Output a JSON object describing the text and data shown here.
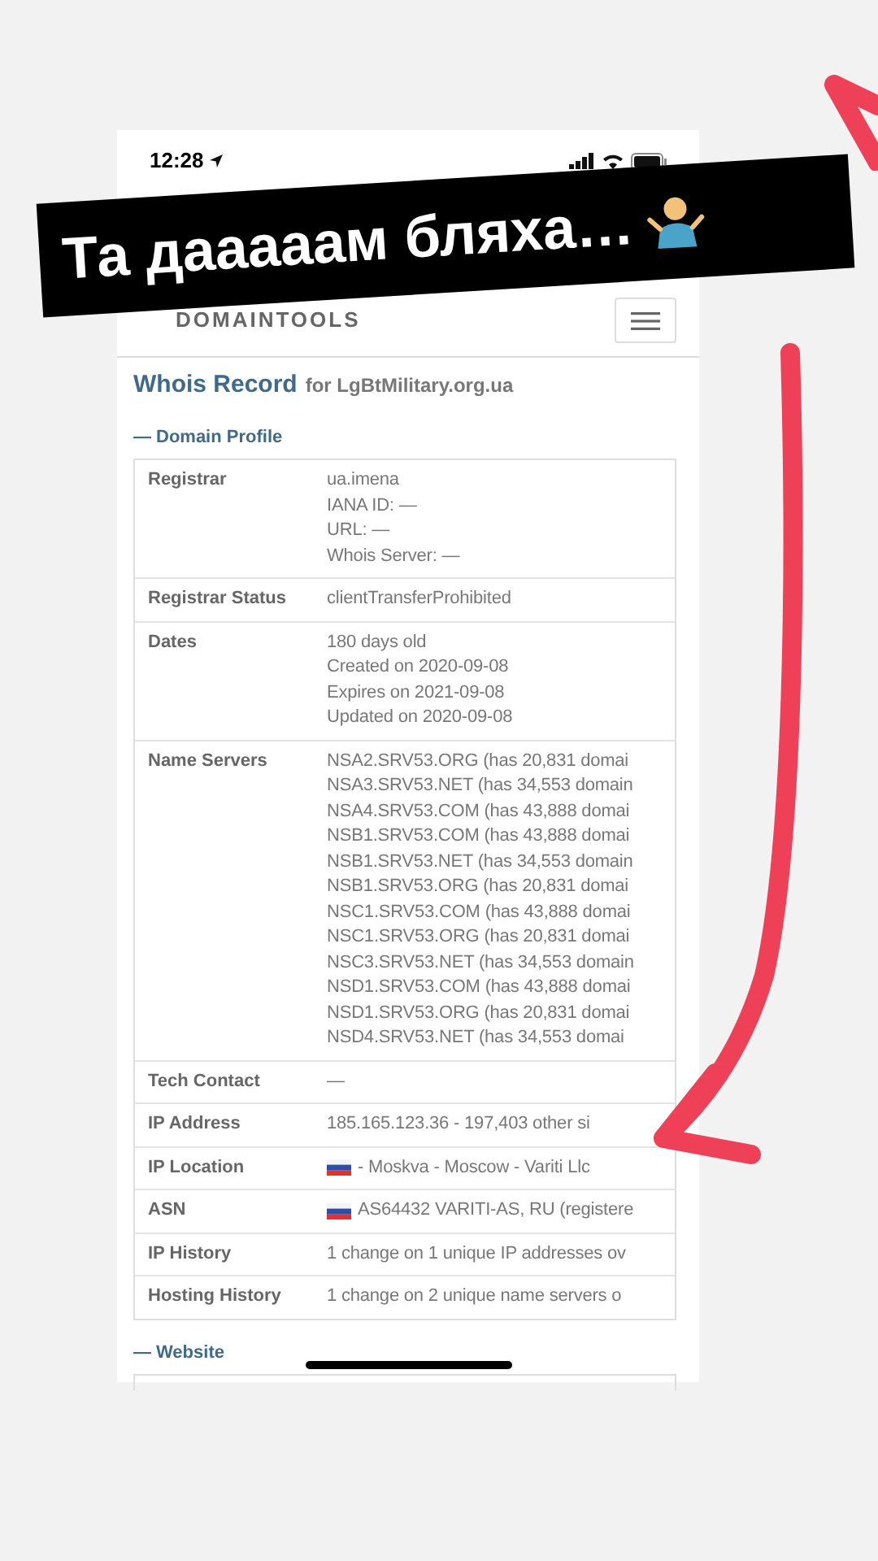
{
  "status_bar": {
    "time": "12:28"
  },
  "sticker": {
    "text": "Та дааааам бляха…"
  },
  "header": {
    "logo": "DOMAINTOOLS"
  },
  "title": {
    "main": "Whois Record",
    "suffix": "for LgBtMilitary.org.ua"
  },
  "sections": [
    {
      "toggle": "—",
      "title": "Domain Profile",
      "expanded": true,
      "rows": [
        {
          "label": "Registrar",
          "lines": [
            "ua.imena",
            "IANA ID: —",
            "URL: —",
            "Whois Server: —"
          ]
        },
        {
          "label": "Registrar Status",
          "lines": [
            "clientTransferProhibited"
          ]
        },
        {
          "label": "Dates",
          "lines": [
            "180 days old",
            "Created on 2020-09-08",
            "Expires on 2021-09-08",
            "Updated on 2020-09-08"
          ]
        },
        {
          "label": "Name Servers",
          "lines": [
            "NSA2.SRV53.ORG (has 20,831 domai",
            "NSA3.SRV53.NET (has 34,553 domain",
            "NSA4.SRV53.COM (has 43,888 domai",
            "NSB1.SRV53.COM (has 43,888 domai",
            "NSB1.SRV53.NET (has 34,553 domain",
            "NSB1.SRV53.ORG (has 20,831 domai",
            "NSC1.SRV53.COM (has 43,888 domai",
            "NSC1.SRV53.ORG (has 20,831 domai",
            "NSC3.SRV53.NET (has 34,553 domain",
            "NSD1.SRV53.COM (has 43,888 domai",
            "NSD1.SRV53.ORG (has 20,831 domai",
            "NSD4.SRV53.NET (has 34,553 domai"
          ]
        },
        {
          "label": "Tech Contact",
          "lines": [
            "—"
          ]
        },
        {
          "label": "IP Address",
          "lines": [
            "185.165.123.36 - 197,403 other si"
          ]
        },
        {
          "label": "IP Location",
          "kind": "flag",
          "lines": [
            "- Moskva - Moscow - Variti Llc"
          ]
        },
        {
          "label": "ASN",
          "kind": "flag",
          "lines": [
            "AS64432 VARITI-AS, RU (registere"
          ]
        },
        {
          "label": "IP History",
          "lines": [
            "1 change on 1 unique IP addresses ov"
          ]
        },
        {
          "label": "Hosting History",
          "lines": [
            "1 change on 2 unique name servers o"
          ]
        }
      ]
    },
    {
      "toggle": "—",
      "title": "Website",
      "expanded": true
    }
  ]
}
